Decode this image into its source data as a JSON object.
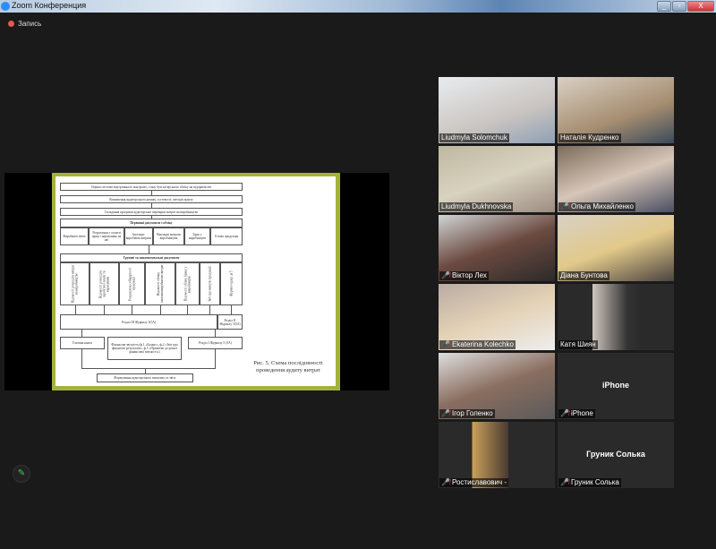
{
  "window": {
    "title": "Zoom Конференция",
    "minimize": "_",
    "maximize": "▫",
    "close": "X"
  },
  "recording": {
    "label": "Запись"
  },
  "slide": {
    "steps": [
      "Оцінка системи внутрішнього контролю, стану бухгалтерського обліку на підприємстві",
      "Визначення аудиторського ризику, суттєвості, методів аудиту",
      "Складання програми аудиторської перевірки витрат на виробництво"
    ],
    "primary_header": "Первинні документи з обліку",
    "primary_cols": [
      "Виробничі звіти",
      "Розрахунки з оплати праці і нарахувань на неї",
      "Загально-виробничі витрати",
      "Накладні витрати виробництва",
      "Брак у виробництві",
      "Готова продукція"
    ],
    "group_header": "Групові та накопичувальні документи",
    "group_cols": [
      "Відомості розподілу витрат на виробництво",
      "Відомості розподілу заробітної плати та нарахувань",
      "Розрахунок собівартості продукції",
      "Відомості обліку загальновиробничих витрат",
      "Відомості обліку браку у виробництві",
      "Звіт про випуск продукції",
      "Журнал-ордер №5"
    ],
    "section3": "Розділ III Журналу 5(5А)",
    "section2": "Розділ II Журналу 5(5А)",
    "ledger": "Головна книга",
    "financial": "Фінансова звітність (ф.1 «Баланс», ф.2 «Звіт про фінансові результати», ф.5 «Примітки до річної фінансової звітності»)",
    "section1": "Розділ I Журналу 5 (5А)",
    "final": "Формування аудиторського висновку та звіту",
    "caption": "Рис. 5. Схема послідовності проведення аудиту витрат",
    "border_color": "#a5b23a"
  },
  "participants": [
    {
      "name": "Liudmyla Solomchuk",
      "muted": false
    },
    {
      "name": "Наталія Кудренко",
      "muted": false
    },
    {
      "name": "Liudmyla Dukhnovska",
      "muted": false
    },
    {
      "name": "Ольга Михайленко",
      "muted": true
    },
    {
      "name": "Віктор Лех",
      "muted": true
    },
    {
      "name": "Діана Бунтова",
      "muted": false
    },
    {
      "name": "Ekaterina Kolechko",
      "muted": true
    },
    {
      "name": "Катя Шиян",
      "muted": false,
      "active": true
    },
    {
      "name": "Ігор Голенко",
      "muted": true
    },
    {
      "name": "iPhone",
      "muted": true,
      "label": "iPhone"
    },
    {
      "name": "Ростиславович -",
      "muted": true
    },
    {
      "name": "Груник Солька",
      "muted": true,
      "label": "Груник Солька"
    }
  ],
  "mute_icon": "🎤̸",
  "annotate_icon": "✎"
}
